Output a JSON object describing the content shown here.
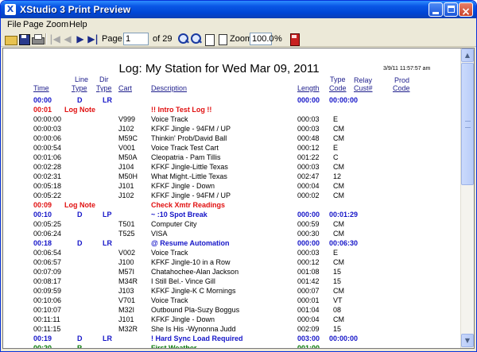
{
  "window": {
    "title": "XStudio 3 Print Preview",
    "app_icon": "X"
  },
  "menu": [
    "File",
    "Page",
    "Zoom",
    "Help"
  ],
  "toolbar": {
    "page_label": "Page",
    "page_value": "1",
    "page_total": "of 29",
    "zoom_label": "Zoom",
    "zoom_value": "100.0",
    "zoom_unit": "%"
  },
  "report": {
    "title": "Log: My Station for Wed Mar 09, 2011",
    "printed_at": "3/9/11 11:57:57  am",
    "headers": {
      "time": "Time",
      "line_top": "Line",
      "line": "Type",
      "dir_top": "Dir",
      "dir": "Type",
      "cart": "Cart",
      "description": "Description",
      "length": "Length",
      "type_top": "Type",
      "type_code": "Code",
      "relay_top": "Relay",
      "relay": "Cust#",
      "prod_top": "Prod",
      "prod": "Code"
    },
    "rows": [
      {
        "kind": "blue",
        "time": "00:00",
        "line": "D",
        "dir": "LR",
        "cart": "",
        "desc": "",
        "length": "000:00",
        "code": "00:00:00"
      },
      {
        "kind": "red",
        "time": "00:01",
        "line": "Log Note",
        "dir": "",
        "cart": "",
        "desc": "!! Intro Test Log !!",
        "length": "",
        "code": ""
      },
      {
        "kind": "normal",
        "time": "00:00:00",
        "line": "",
        "dir": "",
        "cart": "V999",
        "desc": "Voice Track",
        "length": "000:03",
        "code": "E"
      },
      {
        "kind": "normal",
        "time": "00:00:03",
        "line": "",
        "dir": "",
        "cart": "J102",
        "desc": "KFKF Jingle - 94FM / UP",
        "length": "000:03",
        "code": "CM"
      },
      {
        "kind": "normal",
        "time": "00:00:06",
        "line": "",
        "dir": "",
        "cart": "M59C",
        "desc": "Thinkin' Prob/David Ball",
        "length": "000:48",
        "code": "CM"
      },
      {
        "kind": "normal",
        "time": "00:00:54",
        "line": "",
        "dir": "",
        "cart": "V001",
        "desc": "Voice Track Test Cart",
        "length": "000:12",
        "code": "E"
      },
      {
        "kind": "normal",
        "time": "00:01:06",
        "line": "",
        "dir": "",
        "cart": "M50A",
        "desc": "Cleopatria - Pam Tillis",
        "length": "001:22",
        "code": "C"
      },
      {
        "kind": "normal",
        "time": "00:02:28",
        "line": "",
        "dir": "",
        "cart": "J104",
        "desc": "KFKF Jingle-Little Texas",
        "length": "000:03",
        "code": "CM"
      },
      {
        "kind": "normal",
        "time": "00:02:31",
        "line": "",
        "dir": "",
        "cart": "M50H",
        "desc": "What Might.-Little Texas",
        "length": "002:47",
        "code": "12"
      },
      {
        "kind": "normal",
        "time": "00:05:18",
        "line": "",
        "dir": "",
        "cart": "J101",
        "desc": "KFKF Jingle - Down",
        "length": "000:04",
        "code": "CM"
      },
      {
        "kind": "normal",
        "time": "00:05:22",
        "line": "",
        "dir": "",
        "cart": "J102",
        "desc": "KFKF Jingle - 94FM / UP",
        "length": "000:02",
        "code": "CM"
      },
      {
        "kind": "red",
        "time": "00:09",
        "line": "Log Note",
        "dir": "",
        "cart": "",
        "desc": "Check Xmtr Readings",
        "length": "",
        "code": ""
      },
      {
        "kind": "blue",
        "time": "00:10",
        "line": "D",
        "dir": "LP",
        "cart": "",
        "desc": "~ :10 Spot Break",
        "length": "000:00",
        "code": "00:01:29"
      },
      {
        "kind": "normal",
        "time": "00:05:25",
        "line": "",
        "dir": "",
        "cart": "T501",
        "desc": "Computer City",
        "length": "000:59",
        "code": "CM"
      },
      {
        "kind": "normal",
        "time": "00:06:24",
        "line": "",
        "dir": "",
        "cart": "T525",
        "desc": "VISA",
        "length": "000:30",
        "code": "CM"
      },
      {
        "kind": "blue",
        "time": "00:18",
        "line": "D",
        "dir": "LR",
        "cart": "",
        "desc": "@ Resume Automation",
        "length": "000:00",
        "code": "00:06:30"
      },
      {
        "kind": "normal",
        "time": "00:06:54",
        "line": "",
        "dir": "",
        "cart": "V002",
        "desc": "Voice Track",
        "length": "000:03",
        "code": "E"
      },
      {
        "kind": "normal",
        "time": "00:06:57",
        "line": "",
        "dir": "",
        "cart": "J100",
        "desc": "KFKF Jingle-10 in a Row",
        "length": "000:12",
        "code": "CM"
      },
      {
        "kind": "normal",
        "time": "00:07:09",
        "line": "",
        "dir": "",
        "cart": "M57I",
        "desc": "Chatahochee-Alan  Jackson",
        "length": "001:08",
        "code": "15"
      },
      {
        "kind": "normal",
        "time": "00:08:17",
        "line": "",
        "dir": "",
        "cart": "M34R",
        "desc": "I Still Bel.- Vince Gill",
        "length": "001:42",
        "code": "15"
      },
      {
        "kind": "normal",
        "time": "00:09:59",
        "line": "",
        "dir": "",
        "cart": "J103",
        "desc": "KFKF Jingle-K C Mornings",
        "length": "000:07",
        "code": "CM"
      },
      {
        "kind": "normal",
        "time": "00:10:06",
        "line": "",
        "dir": "",
        "cart": "V701",
        "desc": "Voice Track",
        "length": "000:01",
        "code": "VT"
      },
      {
        "kind": "normal",
        "time": "00:10:07",
        "line": "",
        "dir": "",
        "cart": "M32I",
        "desc": "Outbound Pla-Suzy Boggus",
        "length": "001:04",
        "code": "08"
      },
      {
        "kind": "normal",
        "time": "00:11:11",
        "line": "",
        "dir": "",
        "cart": "J101",
        "desc": "KFKF Jingle - Down",
        "length": "000:04",
        "code": "CM"
      },
      {
        "kind": "normal",
        "time": "00:11:15",
        "line": "",
        "dir": "",
        "cart": "M32R",
        "desc": "She Is His -Wynonna Judd",
        "length": "002:09",
        "code": "15"
      },
      {
        "kind": "blue",
        "time": "00:19",
        "line": "D",
        "dir": "LR",
        "cart": "",
        "desc": "! Hard Sync Load Required",
        "length": "003:00",
        "code": "00:00:00"
      },
      {
        "kind": "green",
        "time": "00:20",
        "line": "P",
        "dir": "",
        "cart": "",
        "desc": "First Weather",
        "length": "001:00",
        "code": ""
      }
    ]
  },
  "colors": {
    "titlebar": "#0A57E6",
    "blue_text": "#1515C8",
    "red_text": "#E11010",
    "green_text": "#0A7A0A",
    "header_text": "#1E1E8C"
  }
}
